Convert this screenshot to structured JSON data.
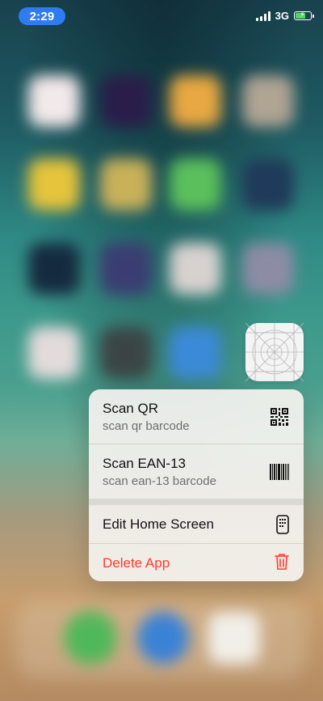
{
  "status_bar": {
    "time": "2:29",
    "network": "3G",
    "signal_bars": 4,
    "battery_level": 0.6,
    "battery_charging": true,
    "time_pill_color": "#2f7bf0"
  },
  "app_icon": {
    "icon": "placeholder-app-icon"
  },
  "menu": {
    "items": [
      {
        "title": "Scan QR",
        "subtitle": "scan qr barcode",
        "icon": "qr-code-icon"
      },
      {
        "title": "Scan EAN-13",
        "subtitle": "scan ean-13 barcode",
        "icon": "barcode-icon"
      },
      {
        "title": "Edit Home Screen",
        "icon": "phone-apps-icon"
      },
      {
        "title": "Delete App",
        "icon": "trash-icon",
        "color": "#ff3b30"
      }
    ]
  }
}
